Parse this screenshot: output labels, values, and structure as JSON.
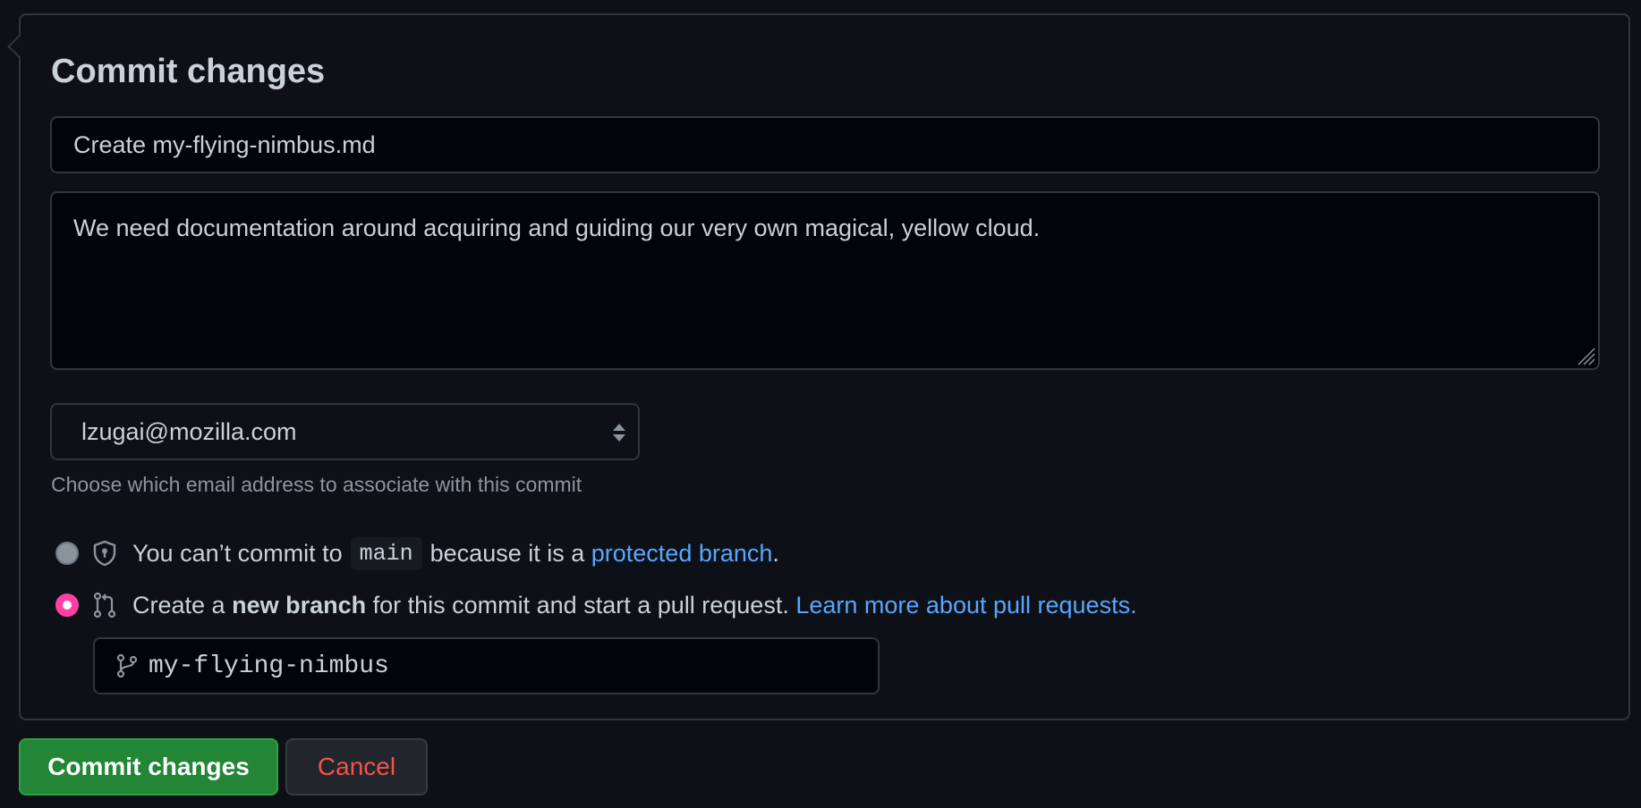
{
  "dialog": {
    "title": "Commit changes"
  },
  "summary": {
    "value": "Create my-flying-nimbus.md"
  },
  "description": {
    "value": "We need documentation around acquiring and guiding our very own magical, yellow cloud."
  },
  "email": {
    "selected": "lzugai@mozilla.com",
    "hint": "Choose which email address to associate with this commit"
  },
  "options": {
    "direct": {
      "text_before": "You can’t commit to",
      "branch_code": "main",
      "text_middle": "because it is a",
      "link": "protected branch",
      "text_after": ".",
      "icon": "shield-lock-icon"
    },
    "new_branch": {
      "text_before": "Create a",
      "bold": "new branch",
      "text_after": "for this commit and start a pull request.",
      "link": "Learn more about pull requests.",
      "icon": "git-pull-request-icon"
    }
  },
  "branch": {
    "value": "my-flying-nimbus",
    "icon": "git-branch-icon"
  },
  "buttons": {
    "commit": "Commit changes",
    "cancel": "Cancel"
  },
  "colors": {
    "background": "#0d1117",
    "border": "#30363d",
    "link": "#58a6ff",
    "commit_button": "#238636",
    "cancel_text": "#f85149",
    "radio_checked": "#ff3fa4"
  }
}
